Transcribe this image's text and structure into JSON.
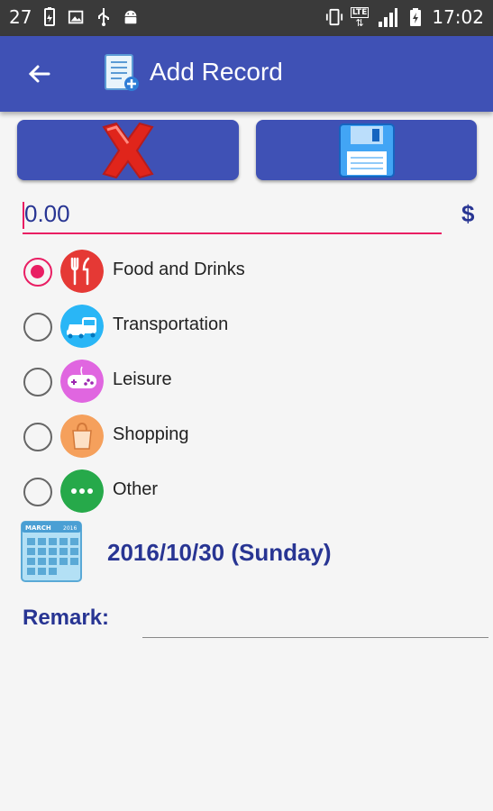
{
  "status_bar": {
    "notification_count": "27",
    "time": "17:02",
    "network_label": "LTE"
  },
  "app_bar": {
    "title": "Add Record",
    "back_icon": "arrow-left-icon",
    "title_icon": "add-document-icon"
  },
  "actions": {
    "cancel_icon": "red-x-icon",
    "save_icon": "floppy-disk-icon"
  },
  "amount": {
    "value": "0.00",
    "currency": "$"
  },
  "categories": [
    {
      "label": "Food and Drinks",
      "icon": "fork-knife-icon",
      "color": "#e53935",
      "selected": true
    },
    {
      "label": "Transportation",
      "icon": "car-bus-icon",
      "color": "#29b6f6",
      "selected": false
    },
    {
      "label": "Leisure",
      "icon": "gamepad-icon",
      "color": "#e066e0",
      "selected": false
    },
    {
      "label": "Shopping",
      "icon": "shopping-bag-icon",
      "color": "#f5a05c",
      "selected": false
    },
    {
      "label": "Other",
      "icon": "more-dots-icon",
      "color": "#26a94a",
      "selected": false
    }
  ],
  "date": {
    "text": "2016/10/30 (Sunday)",
    "calendar_month": "MARCH",
    "calendar_year": "2016"
  },
  "remark": {
    "label": "Remark:",
    "value": ""
  },
  "colors": {
    "primary": "#3f51b5",
    "accent": "#e91e63",
    "text_primary": "#283593"
  }
}
